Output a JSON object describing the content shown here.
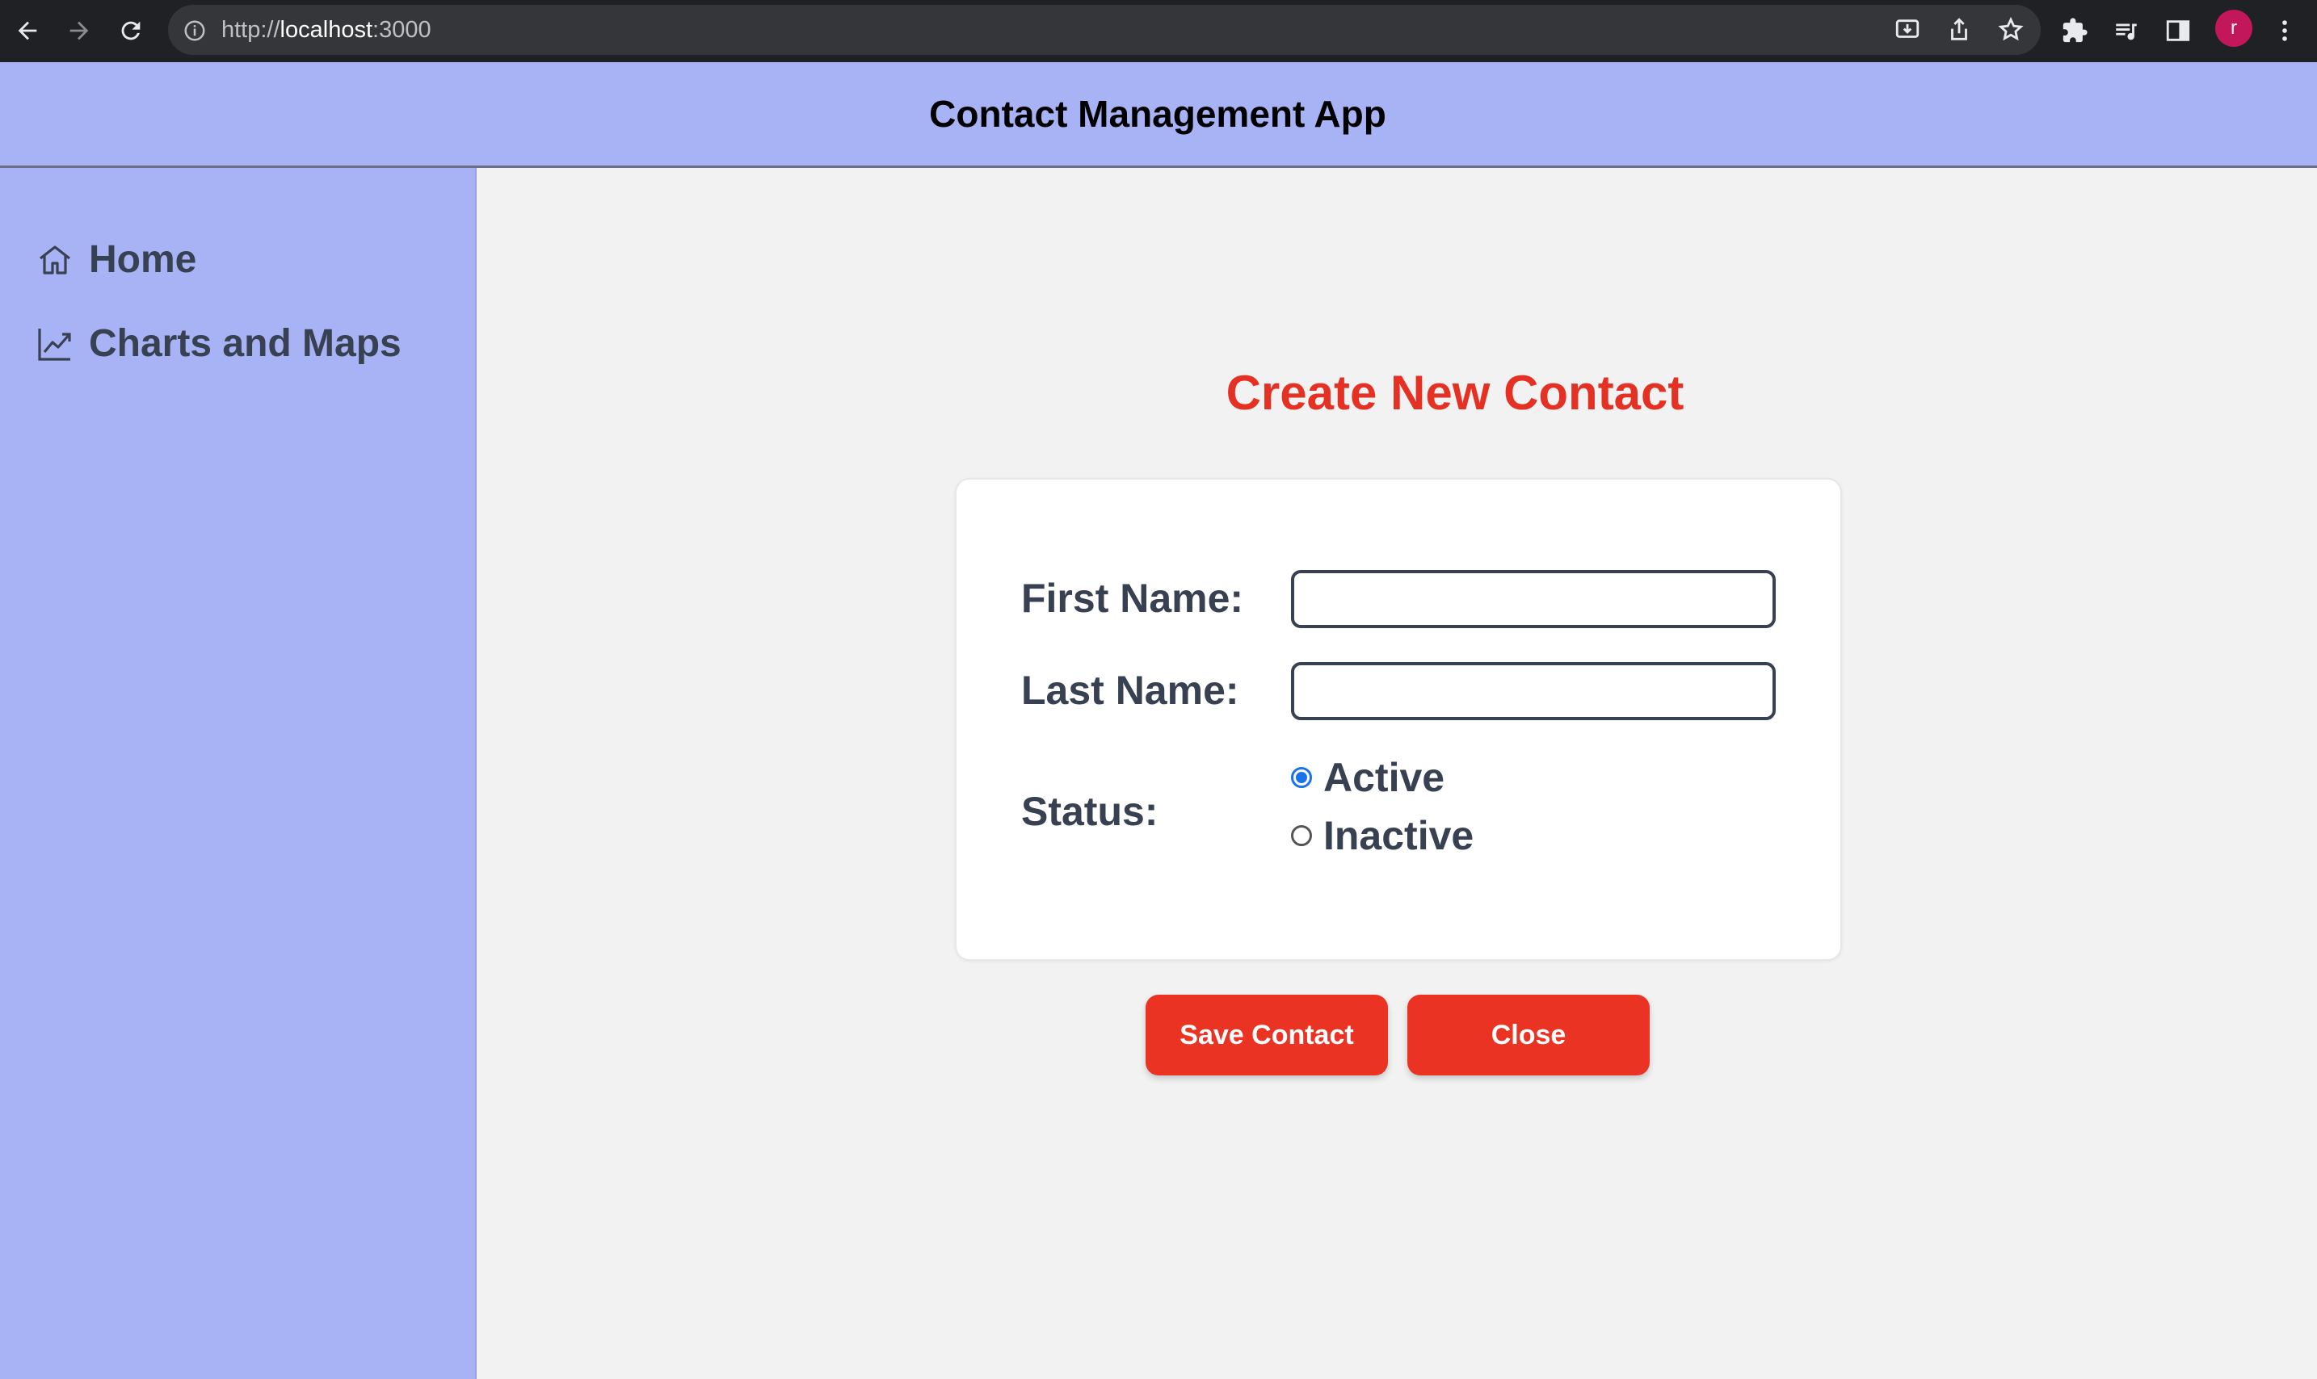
{
  "browser": {
    "url_scheme": "http://",
    "url_host": "localhost",
    "url_port": ":3000",
    "avatar_letter": "r",
    "icons": [
      "back-icon",
      "forward-icon",
      "reload-icon",
      "info-icon",
      "install-icon",
      "share-icon",
      "bookmark-star-icon",
      "extensions-icon",
      "media-queue-icon",
      "side-panel-icon",
      "more-vert-icon"
    ]
  },
  "header": {
    "title": "Contact Management App"
  },
  "sidebar": {
    "items": [
      {
        "label": "Home",
        "icon": "home-icon"
      },
      {
        "label": "Charts and Maps",
        "icon": "chart-line-icon"
      }
    ]
  },
  "form": {
    "title": "Create New Contact",
    "first_name_label": "First Name:",
    "first_name_value": "",
    "last_name_label": "Last Name:",
    "last_name_value": "",
    "status_label": "Status:",
    "status_options": [
      "Active",
      "Inactive"
    ],
    "status_selected": "Active"
  },
  "actions": {
    "save_label": "Save Contact",
    "close_label": "Close"
  },
  "colors": {
    "header_bg": "#a8b3f5",
    "accent_red": "#ea3323",
    "title_red": "#e53124",
    "text_dark": "#374151"
  }
}
